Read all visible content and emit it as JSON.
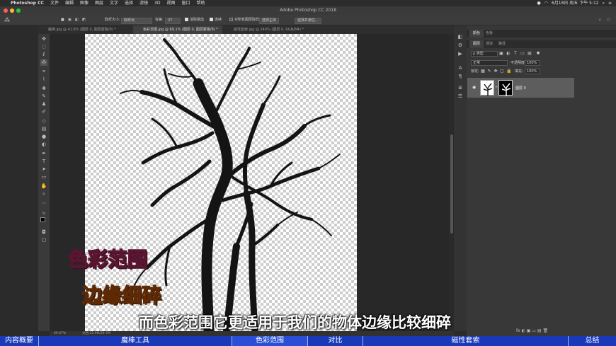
{
  "menubar": {
    "app": "Photoshop CC",
    "items": [
      "文件",
      "编辑",
      "图像",
      "图层",
      "文字",
      "选择",
      "滤镜",
      "3D",
      "视图",
      "窗口",
      "帮助"
    ],
    "clock": "6月18日 周五 下午 5:12"
  },
  "window": {
    "title": "Adobe Photoshop CC 2018"
  },
  "options": {
    "sample_label": "取样大小:",
    "sample_value": "取样点",
    "tolerance_label": "容差:",
    "tolerance_value": "37",
    "antialias_label": "消除锯齿",
    "contiguous_label": "连续",
    "all_layers_label": "对所有图层取样",
    "select_subject_label": "选择主体",
    "select_mask_label": "选择并遮住..."
  },
  "tabs": [
    {
      "label": "魔棒.jpg @ 41.8% (图层 0, 图层蒙版/8) *",
      "active": false
    },
    {
      "label": "色彩范围.jpg @ 69.1% (图层 0, 图层蒙版/8) *",
      "active": true
    },
    {
      "label": "磁性套索.jpg @ 249% (图层 0, RGB/8#) *",
      "active": false
    }
  ],
  "status": {
    "zoom": "69.07%",
    "doc": "文档:22.9M/29.7M"
  },
  "panels": {
    "top_tabs": [
      "颜色",
      "色板"
    ],
    "layer_tabs": [
      "图层",
      "通道",
      "路径"
    ],
    "kind_label": "ρ 类型",
    "blend_mode": "正常",
    "opacity_label": "不透明度:",
    "opacity_value": "100%",
    "lock_label": "锁定:",
    "fill_label": "填充:",
    "fill_value": "100%",
    "layer_name": "图层 0",
    "bottom_icons": "fx ◐ ▣ ▭ ▤ 🗑"
  },
  "overlay": {
    "caption1": "色彩范围",
    "caption2": "边缘细碎",
    "subtitle": "而色彩范围它更适用于我们的物体边缘比较细碎"
  },
  "chapters": [
    {
      "label": "内容概要",
      "active": false
    },
    {
      "label": "魔棒工具",
      "active": false
    },
    {
      "label": "色彩范围",
      "active": true
    },
    {
      "label": "对比",
      "active": false
    },
    {
      "label": "磁性套索",
      "active": false
    },
    {
      "label": "总结",
      "active": false
    }
  ],
  "colors": {
    "chapter_bar": "#1a39b8",
    "caption1": "#f06a9b",
    "caption2": "#f3a22a"
  }
}
